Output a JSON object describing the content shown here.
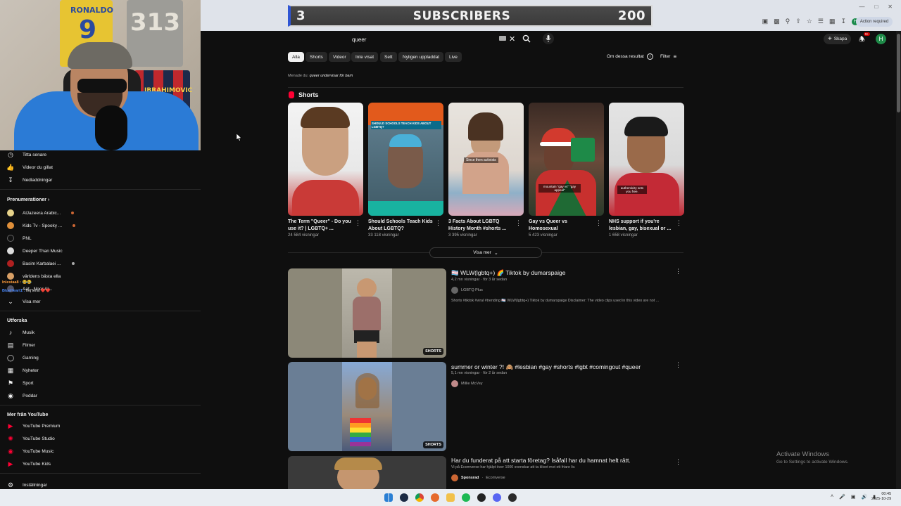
{
  "overlay": {
    "banner_left": "3",
    "banner_title": "SUBSCRIBERS",
    "banner_right": "200"
  },
  "browser": {
    "action_required": "Action required",
    "profile_initial": "H"
  },
  "search": {
    "query": "queer"
  },
  "header": {
    "create_label": "Skapa",
    "notif_count": "9+",
    "avatar_initial": "H"
  },
  "chips": [
    "Alla",
    "Shorts",
    "Videor",
    "Inte visat",
    "Sett",
    "Nyligen uppladdat",
    "Live"
  ],
  "results": {
    "about": "Om dessa resultat",
    "filter": "Filter",
    "context_prefix": "Menade du:",
    "context_link": "queer undervisar för barn"
  },
  "shorts_section": {
    "title": "Shorts",
    "show_more": "Visa mer",
    "items": [
      {
        "title": "The Term \"Queer\" - Do you use it? | LGBTQ+ ...",
        "views": "24 584 visningar"
      },
      {
        "title": "Should Schools Teach Kids About LGBTQ?",
        "views": "33 118 visningar",
        "thumb_text": "SHOULD SCHOOLS TEACH KIDS ABOUT LGBTQ?"
      },
      {
        "title": "3 Facts About LGBTQ History Month #shorts ...",
        "views": "3 395 visningar",
        "thumb_text": "Since then activists"
      },
      {
        "title": "Gay vs Queer vs Homosexual",
        "views": "5 423 visningar",
        "thumb_text": "mountain \"gay vs\" \"gay appeal\""
      },
      {
        "title": "NHS support if you're lesbian, gay, bisexual or ...",
        "views": "1 658 visningar",
        "thumb_text": "authenticity sets you free."
      }
    ]
  },
  "videos": [
    {
      "title": "🏳️‍⚧️ WLW(lgbtq+) 🌈 Tiktok by dumarspaige",
      "meta": "4,2 mn visningar · för 3 år sedan",
      "channel": "LGBTQ Plus",
      "desc": "Shorts #tiktok #viral #trending 🏳️‍⚧️ WLW(lgbtq+) Tiktok by dumarspaige Disclaimer: The video clips used in this video are not ...",
      "badge": "SHORTS"
    },
    {
      "title": "summer or winter ?! 🙈 #lesbian #gay #shorts #lgbt #comingout #queer",
      "meta": "5,1 mn visningar · för 2 år sedan",
      "channel": "Millie McVey",
      "badge": "SHORTS"
    },
    {
      "title": "Har du funderat på att starta företag? Isåfall har du hamnat helt rätt.",
      "desc": "Vi på Ecomverse har hjälpt över 1000 svenskar att ta klivet mot ett friare liv.",
      "sponsored": "Sponsrad",
      "channel": "Ecomverse"
    }
  ],
  "sidebar": {
    "top_items": [
      "Titta senare",
      "Videor du gillat",
      "Nedladdningar"
    ],
    "subscriptions_head": "Prenumerationer",
    "subscriptions": [
      "AlJazeera Arabic...",
      "Kids Tv - Spooky ...",
      "PNL",
      "Deeper Than Music",
      "Basim Karbalaei ...",
      "världens bästa ella",
      "Aat - Noor Al..."
    ],
    "show_more": "Visa mer",
    "explore_head": "Utforska",
    "explore": [
      "Musik",
      "Filmer",
      "Gaming",
      "Nyheter",
      "Sport",
      "Poddar"
    ],
    "more_head": "Mer från YouTube",
    "more": [
      "YouTube Premium",
      "YouTube Studio",
      "YouTube Music",
      "YouTube Kids"
    ],
    "settings": "Inställningar"
  },
  "chat_overlay": {
    "line1_user": "Inlestaa8 :",
    "line1_text": "😂😂",
    "line2_user": "BlueHeart1 :",
    "line2_text": "hej lena ❤️❤️"
  },
  "windows": {
    "activate_title": "Activate Windows",
    "activate_sub": "Go to Settings to activate Windows.",
    "time": "00:45",
    "date": "2025-10-29"
  }
}
